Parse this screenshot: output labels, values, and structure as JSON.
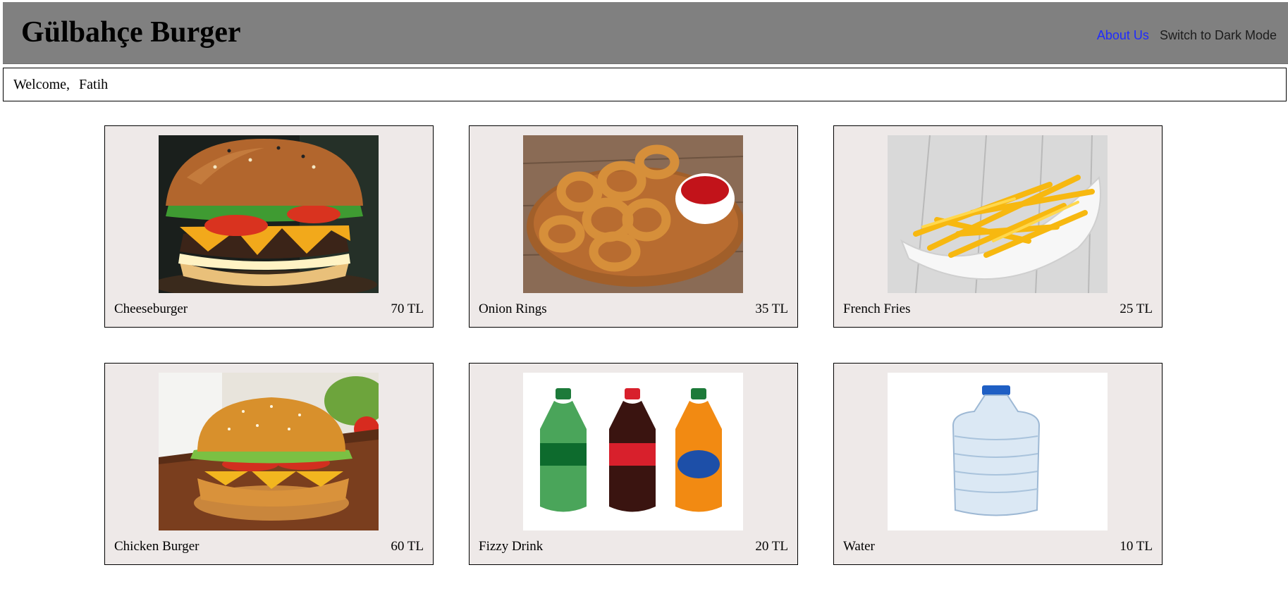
{
  "header": {
    "title": "Gülbahçe Burger",
    "nav": {
      "about_label": "About Us",
      "mode_label": "Switch to Dark Mode"
    }
  },
  "welcome": {
    "greeting": "Welcome,",
    "user_name": "Fatih"
  },
  "menu": [
    {
      "name": "Cheeseburger",
      "price": "70 TL",
      "image": "cheeseburger-photo"
    },
    {
      "name": "Onion Rings",
      "price": "35 TL",
      "image": "onion-rings-photo"
    },
    {
      "name": "French Fries",
      "price": "25 TL",
      "image": "french-fries-photo"
    },
    {
      "name": "Chicken Burger",
      "price": "60 TL",
      "image": "chicken-burger-photo"
    },
    {
      "name": "Fizzy Drink",
      "price": "20 TL",
      "image": "fizzy-drink-photo"
    },
    {
      "name": "Water",
      "price": "10 TL",
      "image": "water-bottle-photo"
    }
  ],
  "colors": {
    "header_bg": "#808080",
    "card_bg": "#eee9e8",
    "link": "#1f2bff"
  }
}
